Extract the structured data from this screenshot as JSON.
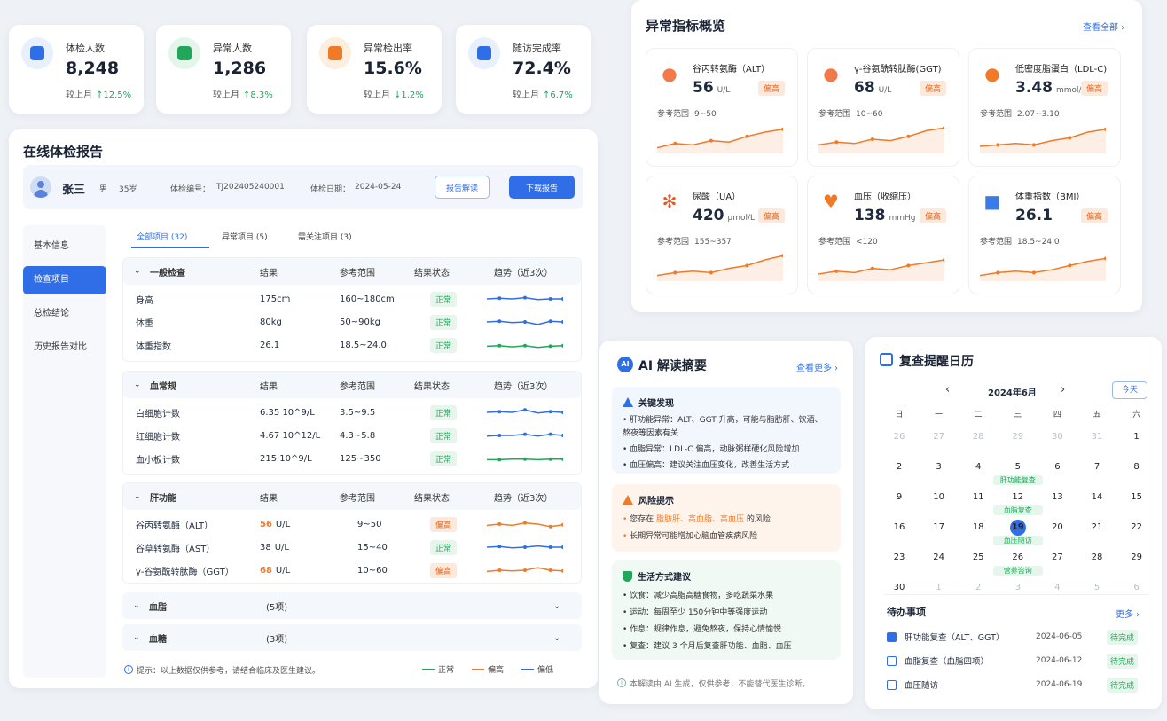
{
  "stats": [
    {
      "label": "体检人数",
      "value": "8,248",
      "compare_label": "较上月",
      "change": "↑12.5%",
      "icon": "user-icon",
      "color": "#2f6ee6",
      "bg": "#e8f0fd"
    },
    {
      "label": "异常人数",
      "value": "1,286",
      "compare_label": "较上月",
      "change": "↑8.3%",
      "icon": "clipboard-icon",
      "color": "#23a55a",
      "bg": "#e4f6ea"
    },
    {
      "label": "异常检出率",
      "value": "15.6%",
      "compare_label": "较上月",
      "change": "↓1.2%",
      "icon": "warning-icon",
      "color": "#f07a28",
      "bg": "#fdeedd"
    },
    {
      "label": "随访完成率",
      "value": "72.4%",
      "compare_label": "较上月",
      "change": "↑6.7%",
      "icon": "shield-check-icon",
      "color": "#2f6ee6",
      "bg": "#e8f0fd"
    }
  ],
  "report": {
    "title": "在线体检报告",
    "patient": {
      "name": "张三",
      "gender": "男",
      "age": "35岁",
      "id_label": "体检编号：",
      "id": "TJ202405240001",
      "date_label": "体检日期：",
      "date": "2024-05-24"
    },
    "interpret_button": "报告解读",
    "download_button": "下载报告",
    "side_nav": [
      "基本信息",
      "检查项目",
      "总检结论",
      "历史报告对比"
    ],
    "active_nav": 1,
    "tabs": [
      "全部项目 (32)",
      "异常项目 (5)",
      "需关注项目 (3)"
    ],
    "columns": {
      "result": "结果",
      "range": "参考范围",
      "status": "结果状态",
      "trend": "趋势（近3次）"
    },
    "sections": [
      {
        "name": "一般检查",
        "rows": [
          {
            "item": "身高",
            "result": "175cm",
            "range": "160~180cm",
            "status": "正常"
          },
          {
            "item": "体重",
            "result": "80kg",
            "range": "50~90kg",
            "status": "正常"
          },
          {
            "item": "体重指数",
            "result": "26.1",
            "range": "18.5~24.0",
            "status": "正常"
          }
        ]
      },
      {
        "name": "血常规",
        "rows": [
          {
            "item": "白细胞计数",
            "result": "6.35  10^9/L",
            "range": "3.5~9.5",
            "status": "正常"
          },
          {
            "item": "红细胞计数",
            "result": "4.67  10^12/L",
            "range": "4.3~5.8",
            "status": "正常"
          },
          {
            "item": "血小板计数",
            "result": "215  10^9/L",
            "range": "125~350",
            "status": "正常"
          }
        ]
      },
      {
        "name": "肝功能",
        "rows": [
          {
            "item": "谷丙转氨酶（ALT）",
            "result_num": "56",
            "result_unit": "U/L",
            "range": "9~50",
            "status": "偏高"
          },
          {
            "item": "谷草转氨酶（AST）",
            "result_num": "38",
            "result_unit": "U/L",
            "range": "15~40",
            "status": "正常"
          },
          {
            "item": "γ-谷氨酰转肽酶（GGT）",
            "result_num": "68",
            "result_unit": "U/L",
            "range": "10~60",
            "status": "偏高"
          }
        ]
      }
    ],
    "collapsed": [
      {
        "name": "血脂",
        "count": "(5项)"
      },
      {
        "name": "血糖",
        "count": "(3项)"
      }
    ],
    "footnote": "提示：以上数据仅供参考，请结合临床及医生建议。",
    "legend": [
      "正常",
      "偏高",
      "偏低"
    ]
  },
  "abnormal": {
    "title": "异常指标概览",
    "view_all": "查看全部 ›",
    "ref_label": "参考范围",
    "badge": "偏高",
    "items": [
      {
        "name": "谷丙转氨酶（ALT）",
        "value": "56",
        "unit": "U/L",
        "range": "9~50",
        "icon": "liver-icon"
      },
      {
        "name": "γ-谷氨酰转肽酶(GGT)",
        "value": "68",
        "unit": "U/L",
        "range": "10~60",
        "icon": "liver-icon"
      },
      {
        "name": "低密度脂蛋白（LDL-C)",
        "value": "3.48",
        "unit": "mmol/L",
        "range": "2.07~3.10",
        "icon": "blood-drop-icon"
      },
      {
        "name": "尿酸（UA）",
        "value": "420",
        "unit": "μmol/L",
        "range": "155~357",
        "icon": "molecule-icon"
      },
      {
        "name": "血压（收缩压）",
        "value": "138",
        "unit": "mmHg",
        "range": "<120",
        "icon": "heart-icon"
      },
      {
        "name": "体重指数（BMI）",
        "value": "26.1",
        "unit": "",
        "range": "18.5~24.0",
        "icon": "scale-icon"
      }
    ]
  },
  "ai": {
    "badge": "AI",
    "title": "AI 解读摘要",
    "more": "查看更多 ›",
    "findings_title": "关键发现",
    "findings": [
      "肝功能异常：ALT、GGT 升高，可能与脂肪肝、饮酒、熬夜等因素有关",
      "血脂异常：LDL-C 偏高，动脉粥样硬化风险增加",
      "血压偏高：建议关注血压变化，改善生活方式"
    ],
    "risk_title": "风险提示",
    "risk_prefix": "您存在 ",
    "risk_terms": "脂肪肝、高血脂、高血压",
    "risk_suffix": " 的风险",
    "risk_2": "长期异常可能增加心脑血管疾病风险",
    "life_title": "生活方式建议",
    "life": [
      "饮食：减少高脂高糖食物，多吃蔬菜水果",
      "运动：每周至少 150分钟中等强度运动",
      "作息：规律作息，避免熬夜，保持心情愉悦",
      "复查：建议 3 个月后复查肝功能、血脂、血压"
    ],
    "disclaimer": "本解读由 AI 生成，仅供参考，不能替代医生诊断。"
  },
  "calendar": {
    "title": "复查提醒日历",
    "month": "2024年6月",
    "today_button": "今天",
    "weekdays": [
      "日",
      "一",
      "二",
      "三",
      "四",
      "五",
      "六"
    ],
    "weeks": [
      [
        "26",
        "27",
        "28",
        "29",
        "30",
        "31",
        "1"
      ],
      [
        "2",
        "3",
        "4",
        "5",
        "6",
        "7",
        "8"
      ],
      [
        "9",
        "10",
        "11",
        "12",
        "13",
        "14",
        "15"
      ],
      [
        "16",
        "17",
        "18",
        "19",
        "20",
        "21",
        "22"
      ],
      [
        "23",
        "24",
        "25",
        "26",
        "27",
        "28",
        "29"
      ],
      [
        "30",
        "1",
        "2",
        "3",
        "4",
        "5",
        "6"
      ]
    ],
    "events": {
      "r1c3": "肝功能复查",
      "r2c3": "血脂复查",
      "r3c3": "血压随访",
      "r4c3": "营养咨询"
    },
    "todo_title": "待办事项",
    "todo_more": "更多 ›",
    "todos": [
      {
        "name": "肝功能复查（ALT、GGT）",
        "date": "2024-06-05",
        "status": "待完成"
      },
      {
        "name": "血脂复查（血脂四项）",
        "date": "2024-06-12",
        "status": "待完成"
      },
      {
        "name": "血压随访",
        "date": "2024-06-19",
        "status": "待完成"
      }
    ]
  }
}
